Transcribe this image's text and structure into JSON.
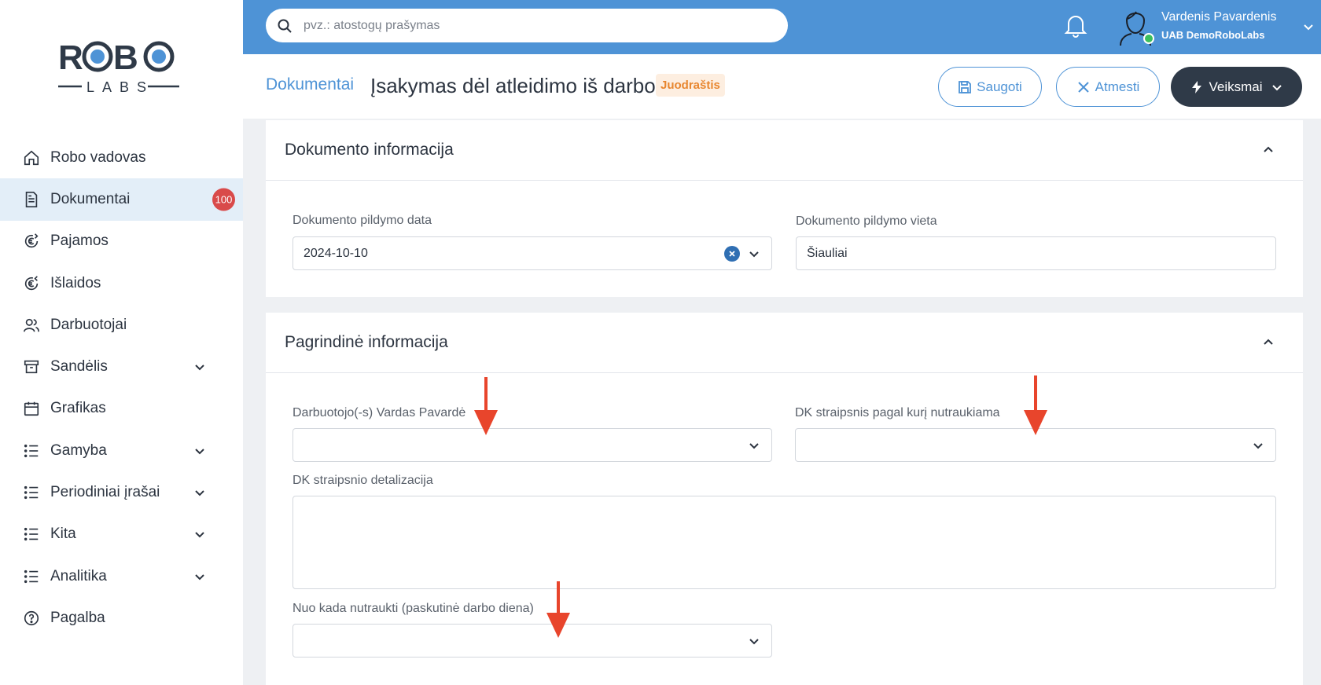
{
  "brand": {
    "logo_top": "ROBO",
    "logo_bottom": "LABS"
  },
  "search": {
    "placeholder": "pvz.: atostogų prašymas"
  },
  "user": {
    "name": "Vardenis Pavardenis",
    "company": "UAB DemoRoboLabs"
  },
  "sidebar": {
    "items": [
      {
        "label": "Robo vadovas",
        "icon": "home-icon"
      },
      {
        "label": "Dokumentai",
        "icon": "document-icon",
        "active": true,
        "badge": "100"
      },
      {
        "label": "Pajamos",
        "icon": "euro-in-icon"
      },
      {
        "label": "Išlaidos",
        "icon": "euro-out-icon"
      },
      {
        "label": "Darbuotojai",
        "icon": "users-icon"
      },
      {
        "label": "Sandėlis",
        "icon": "archive-icon",
        "expandable": true
      },
      {
        "label": "Grafikas",
        "icon": "calendar-icon"
      },
      {
        "label": "Gamyba",
        "icon": "list-icon",
        "expandable": true
      },
      {
        "label": "Periodiniai įrašai",
        "icon": "list-icon",
        "expandable": true
      },
      {
        "label": "Kita",
        "icon": "list-icon",
        "expandable": true
      },
      {
        "label": "Analitika",
        "icon": "list-icon",
        "expandable": true
      },
      {
        "label": "Pagalba",
        "icon": "help-icon"
      }
    ]
  },
  "header": {
    "breadcrumb": "Dokumentai",
    "title": "Įsakymas dėl atleidimo iš darbo",
    "status": "Juodraštis",
    "save_label": "Saugoti",
    "cancel_label": "Atmesti",
    "actions_label": "Veiksmai"
  },
  "doc_info": {
    "title": "Dokumento informacija",
    "date_label": "Dokumento pildymo data",
    "date_value": "2024-10-10",
    "place_label": "Dokumento pildymo vieta",
    "place_value": "Šiauliai"
  },
  "main_info": {
    "title": "Pagrindinė informacija",
    "employee_label": "Darbuotojo(-s) Vardas Pavardė",
    "article_label": "DK straipsnis pagal kurį nutraukiama",
    "detail_label": "DK straipsnio detalizacija",
    "end_date_label": "Nuo kada nutraukti (paskutinė darbo diena)"
  },
  "colors": {
    "primary": "#4e93d6",
    "dark": "#2f3a48",
    "annotation": "#e8452c",
    "badge": "#d94a4a",
    "draft": "#e8862e"
  }
}
